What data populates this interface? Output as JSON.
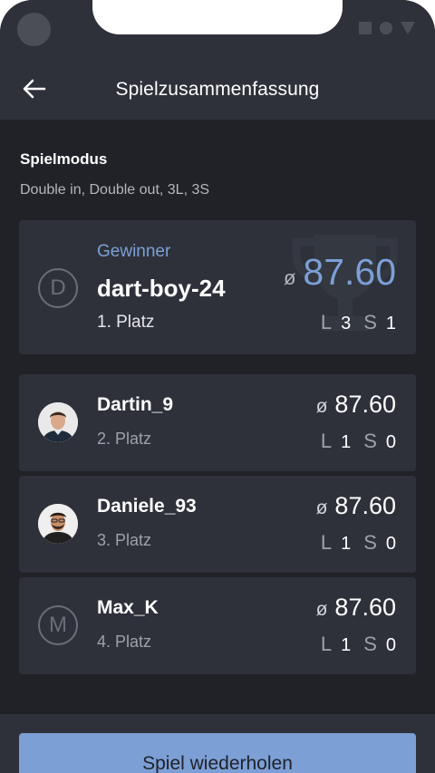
{
  "header": {
    "title": "Spielzusammenfassung"
  },
  "mode": {
    "heading": "Spielmodus",
    "value": "Double in, Double out, 3L, 3S"
  },
  "winner": {
    "label": "Gewinner",
    "initial": "D",
    "name": "dart-boy-24",
    "place": "1. Platz",
    "avg_symbol": "ø",
    "avg": "87.60",
    "legs_label": "L",
    "legs": "3",
    "sets_label": "S",
    "sets": "1"
  },
  "players": [
    {
      "name": "Dartin_9",
      "place": "2. Platz",
      "avatar": "photo",
      "avg_symbol": "ø",
      "avg": "87.60",
      "legs_label": "L",
      "legs": "1",
      "sets_label": "S",
      "sets": "0"
    },
    {
      "name": "Daniele_93",
      "place": "3. Platz",
      "avatar": "photo",
      "avg_symbol": "ø",
      "avg": "87.60",
      "legs_label": "L",
      "legs": "1",
      "sets_label": "S",
      "sets": "0"
    },
    {
      "name": "Max_K",
      "place": "4. Platz",
      "avatar": "initial",
      "initial": "M",
      "avg_symbol": "ø",
      "avg": "87.60",
      "legs_label": "L",
      "legs": "1",
      "sets_label": "S",
      "sets": "0"
    }
  ],
  "footer": {
    "button_label": "Spiel wiederholen"
  },
  "colors": {
    "background": "#202228",
    "surface": "#2e313a",
    "accent": "#7c9fd6"
  },
  "icons": {
    "back": "arrow-left-icon",
    "trophy": "trophy-icon"
  }
}
